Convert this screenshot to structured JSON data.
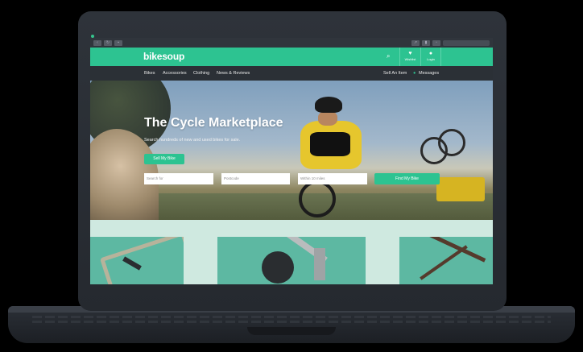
{
  "browser": {
    "toolbar_icons": [
      "back-icon",
      "refresh-icon",
      "lock-icon",
      "share-icon",
      "bookmark-icon",
      "tabs-icon"
    ]
  },
  "site": {
    "brand": "bikesoup",
    "header": {
      "wishlist_label": "Wishlist",
      "login_label": "Login"
    },
    "nav": {
      "items": [
        "Bikes",
        "Accessories",
        "Clothing",
        "News & Reviews"
      ],
      "sell_label": "Sell An Item",
      "messages_label": "Messages"
    },
    "hero": {
      "title": "The Cycle Marketplace",
      "subtitle": "Search hundreds of new and used bikes for sale.",
      "sell_button": "Sell My Bike",
      "search_placeholder": "Search for",
      "postcode_placeholder": "Postcode",
      "distance_value": "Within 10 miles",
      "find_button": "Find My Bike"
    }
  },
  "colors": {
    "brand_green": "#2dc391",
    "nav_bg": "#2b3036",
    "card_bg": "#5db8a2"
  }
}
